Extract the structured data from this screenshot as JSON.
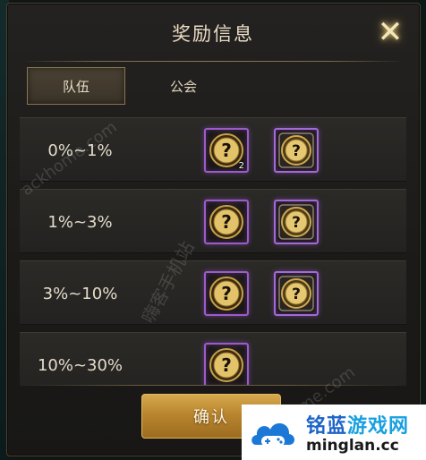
{
  "dialog": {
    "title": "奖励信息",
    "close_icon": "close-icon",
    "confirm_label": "确认"
  },
  "tabs": [
    {
      "label": "队伍",
      "active": true
    },
    {
      "label": "公会",
      "active": false
    }
  ],
  "reward_rows": [
    {
      "range": "0%~1%",
      "rewards": [
        {
          "item": "mystery-coin-icon",
          "count": "2",
          "frame": "purple"
        },
        {
          "item": "gold-coin-icon",
          "count": "",
          "frame": "purple-ornate"
        }
      ]
    },
    {
      "range": "1%~3%",
      "rewards": [
        {
          "item": "mystery-coin-icon",
          "count": "",
          "frame": "purple"
        },
        {
          "item": "gold-coin-icon",
          "count": "",
          "frame": "purple-ornate"
        }
      ]
    },
    {
      "range": "3%~10%",
      "rewards": [
        {
          "item": "mystery-coin-icon",
          "count": "",
          "frame": "purple"
        },
        {
          "item": "gold-coin-icon",
          "count": "",
          "frame": "purple-ornate"
        }
      ]
    },
    {
      "range": "10%~30%",
      "rewards": [
        {
          "item": "mystery-coin-icon",
          "count": "",
          "frame": "purple"
        }
      ]
    }
  ],
  "watermarks": {
    "site_text": "ackhome.com",
    "site_text_lower": "ackhome.com",
    "cn_text": "嗨客手机站"
  },
  "logo": {
    "name_part1": "铭蓝",
    "name_part2": "游戏网",
    "url": "minglan.cc"
  },
  "colors": {
    "panel_bg": "#1f1e1b",
    "accent_gold": "#c8973c",
    "frame_purple": "#9a5cc8",
    "title_text": "#e9dcc4"
  }
}
